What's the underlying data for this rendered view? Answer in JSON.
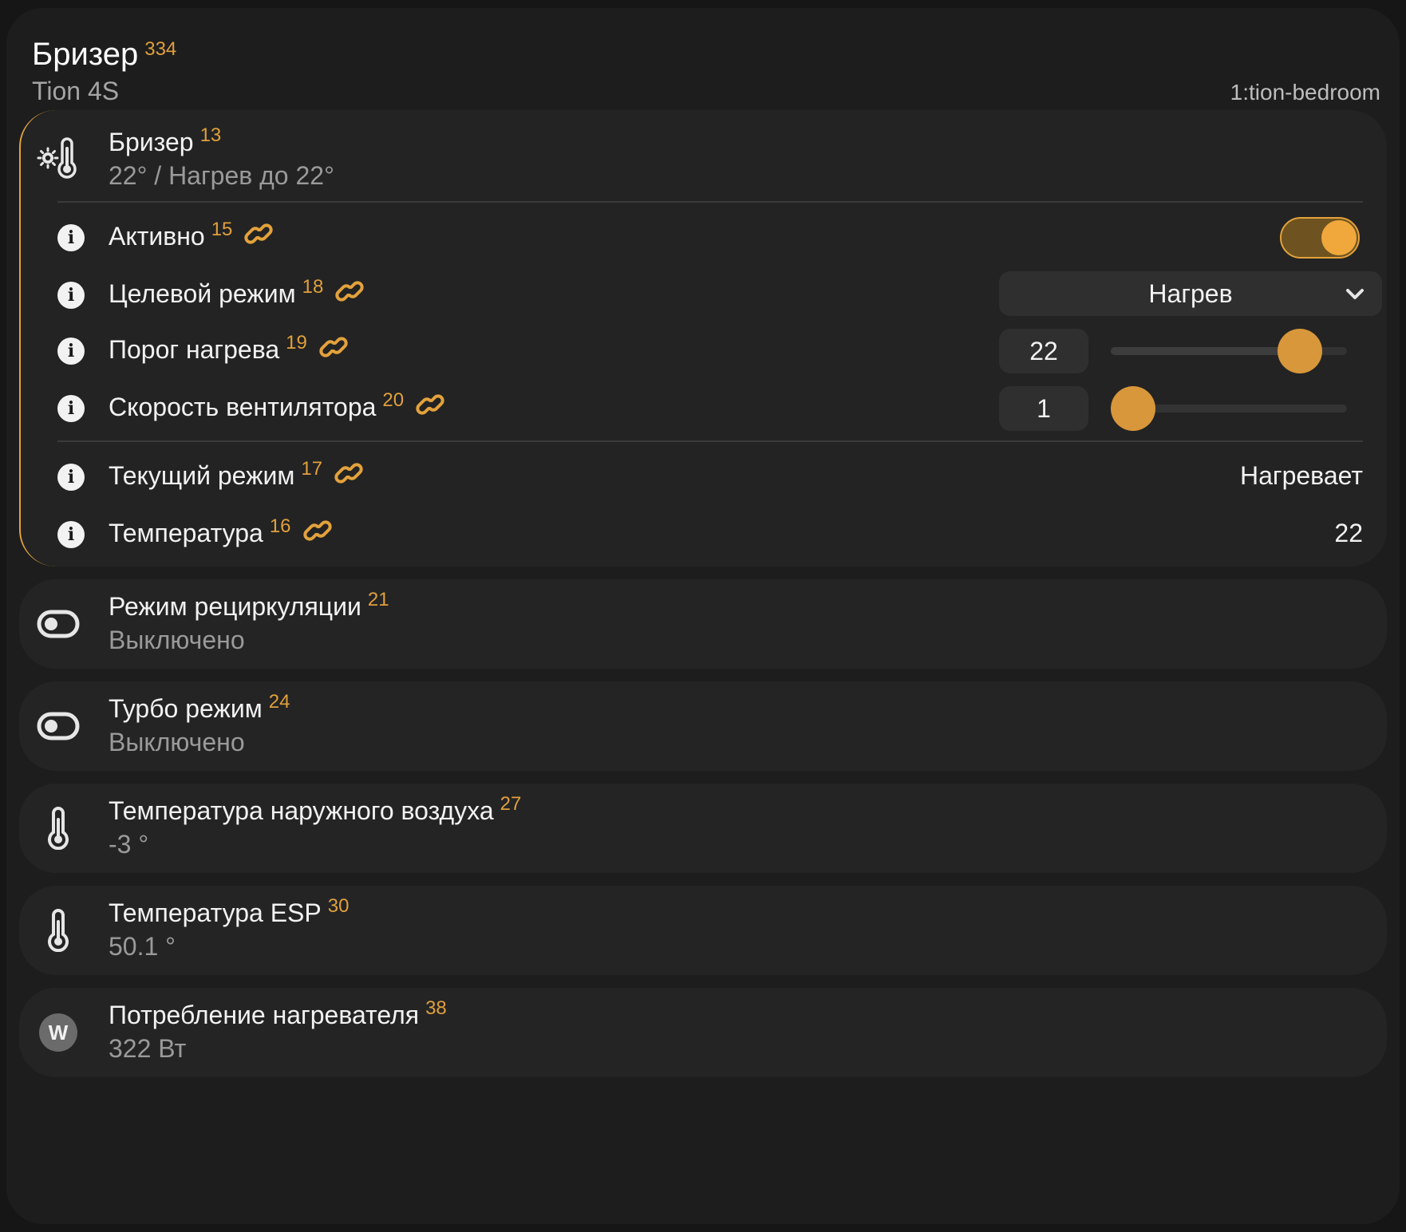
{
  "header": {
    "title": "Бризер",
    "id": "334",
    "subtitle": "Tion 4S",
    "room": "1:tion-bedroom"
  },
  "climate": {
    "icon": "thermostat-icon",
    "title": "Бризер",
    "id": "13",
    "status": "22° / Нагрев до 22°",
    "rows": {
      "active": {
        "label": "Активно",
        "id": "15",
        "on": true
      },
      "target_mode": {
        "label": "Целевой режим",
        "id": "18",
        "value": "Нагрев"
      },
      "heat_threshold": {
        "label": "Порог нагрева",
        "id": "19",
        "value": "22",
        "slider_fraction": 0.87
      },
      "fan_speed": {
        "label": "Скорость вентилятора",
        "id": "20",
        "value": "1",
        "slider_fraction": 0.0
      },
      "current_mode": {
        "label": "Текущий режим",
        "id": "17",
        "value": "Нагревает"
      },
      "temperature": {
        "label": "Температура",
        "id": "16",
        "value": "22"
      }
    }
  },
  "entities": [
    {
      "icon": "toggle-switch-icon",
      "title": "Режим рециркуляции",
      "id": "21",
      "value": "Выключено"
    },
    {
      "icon": "toggle-switch-icon",
      "title": "Турбо режим",
      "id": "24",
      "value": "Выключено"
    },
    {
      "icon": "thermometer-icon",
      "title": "Температура наружного воздуха",
      "id": "27",
      "value": "-3 °"
    },
    {
      "icon": "thermometer-icon",
      "title": "Температура ESP",
      "id": "30",
      "value": "50.1 °"
    },
    {
      "icon": "watt-icon",
      "badge": "W",
      "title": "Потребление нагревателя",
      "id": "38",
      "value": "322 Вт"
    }
  ],
  "colors": {
    "accent": "#e3a23c",
    "background": "#1d1d1d",
    "card": "#242424"
  }
}
